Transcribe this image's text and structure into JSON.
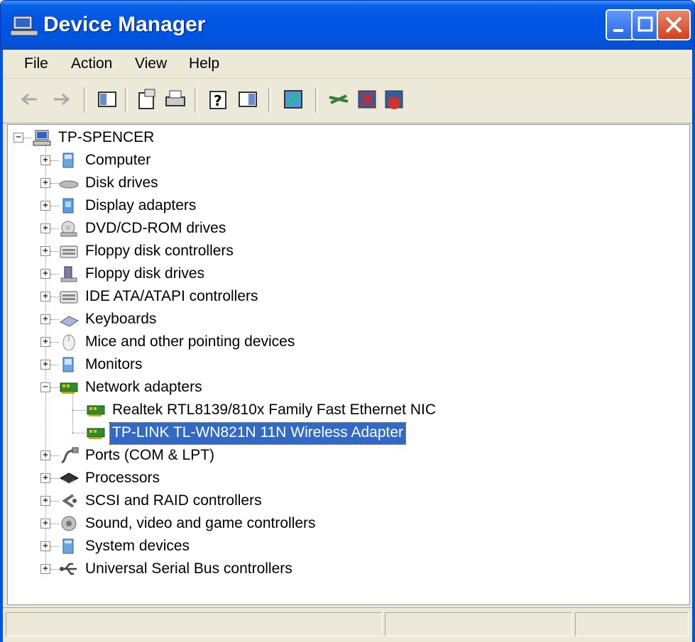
{
  "window": {
    "title": "Device Manager"
  },
  "menu": [
    "File",
    "Action",
    "View",
    "Help"
  ],
  "toolbar": [
    "back-arrow-icon",
    "forward-arrow-icon",
    "show-hide-console-tree-icon",
    "properties-icon",
    "print-icon",
    "help-icon",
    "show-hide-action-pane-icon",
    "scan-hardware-icon",
    "update-driver-icon",
    "uninstall-icon",
    "disable-icon"
  ],
  "tree": {
    "root": "TP-SPENCER",
    "categories": [
      {
        "label": "Computer",
        "icon": "computer-icon"
      },
      {
        "label": "Disk drives",
        "icon": "disk-drive-icon"
      },
      {
        "label": "Display adapters",
        "icon": "display-adapter-icon"
      },
      {
        "label": "DVD/CD-ROM drives",
        "icon": "dvd-drive-icon"
      },
      {
        "label": "Floppy disk controllers",
        "icon": "controller-icon"
      },
      {
        "label": "Floppy disk drives",
        "icon": "floppy-drive-icon"
      },
      {
        "label": "IDE ATA/ATAPI controllers",
        "icon": "controller-icon"
      },
      {
        "label": "Keyboards",
        "icon": "keyboard-icon"
      },
      {
        "label": "Mice and other pointing devices",
        "icon": "mouse-icon"
      },
      {
        "label": "Monitors",
        "icon": "monitor-icon"
      },
      {
        "label": "Network adapters",
        "icon": "network-card-icon"
      },
      {
        "label": "Ports (COM & LPT)",
        "icon": "port-icon"
      },
      {
        "label": "Processors",
        "icon": "processor-icon"
      },
      {
        "label": "SCSI and RAID controllers",
        "icon": "scsi-icon"
      },
      {
        "label": "Sound, video and game controllers",
        "icon": "sound-icon"
      },
      {
        "label": "System devices",
        "icon": "system-device-icon"
      },
      {
        "label": "Universal Serial Bus controllers",
        "icon": "usb-icon"
      }
    ],
    "network_children": [
      {
        "label": "Realtek RTL8139/810x Family Fast Ethernet NIC",
        "icon": "network-card-icon"
      },
      {
        "label": "TP-LINK TL-WN821N 11N Wireless Adapter",
        "icon": "network-card-icon"
      }
    ],
    "selected": "TP-LINK TL-WN821N 11N Wireless Adapter"
  },
  "colors": {
    "titlebar": "#0054e0",
    "selection": "#316ac5",
    "chrome": "#ece9d8"
  }
}
